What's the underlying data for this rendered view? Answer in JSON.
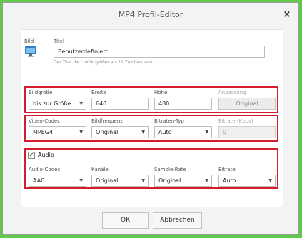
{
  "window": {
    "title": "MP4 Profil-Editor",
    "close_glyph": "×"
  },
  "general": {
    "image_label": "Bild",
    "image_icon": "monitor-icon",
    "title_label": "Titel",
    "title_value": "Benutzerdefiniert",
    "title_hint": "Der Titel darf nicht größer als 21 Zeichen sein"
  },
  "size_group": {
    "picture_size": {
      "label": "Bildgröße",
      "value": "bis zur Größe"
    },
    "width": {
      "label": "Breite",
      "value": "640"
    },
    "height": {
      "label": "Höhe",
      "value": "480"
    },
    "fit": {
      "label": "Anpassung",
      "button": "Original"
    }
  },
  "video_group": {
    "codec": {
      "label": "Video-Codec",
      "value": "MPEG4"
    },
    "framerate": {
      "label": "Bildfrequenz",
      "value": "Original"
    },
    "bitrate_type": {
      "label": "Bitraten-Typ",
      "value": "Auto"
    },
    "bitrate": {
      "label": "Bitrate (Kbps)",
      "value": "0"
    }
  },
  "audio_group": {
    "enabled_label": "Audio",
    "enabled": true,
    "check_glyph": "✔",
    "codec": {
      "label": "Audio-Codec",
      "value": "AAC"
    },
    "channels": {
      "label": "Kanäle",
      "value": "Original"
    },
    "sample_rate": {
      "label": "Sample-Rate",
      "value": "Original"
    },
    "bitrate": {
      "label": "Bitrate",
      "value": "Auto"
    }
  },
  "footer": {
    "ok_label": "OK",
    "cancel_label": "Abbrechen"
  },
  "colors": {
    "highlight": "#d51c2c",
    "outer_frame": "#5fc94a",
    "checkbox": "#3c9c3c"
  }
}
